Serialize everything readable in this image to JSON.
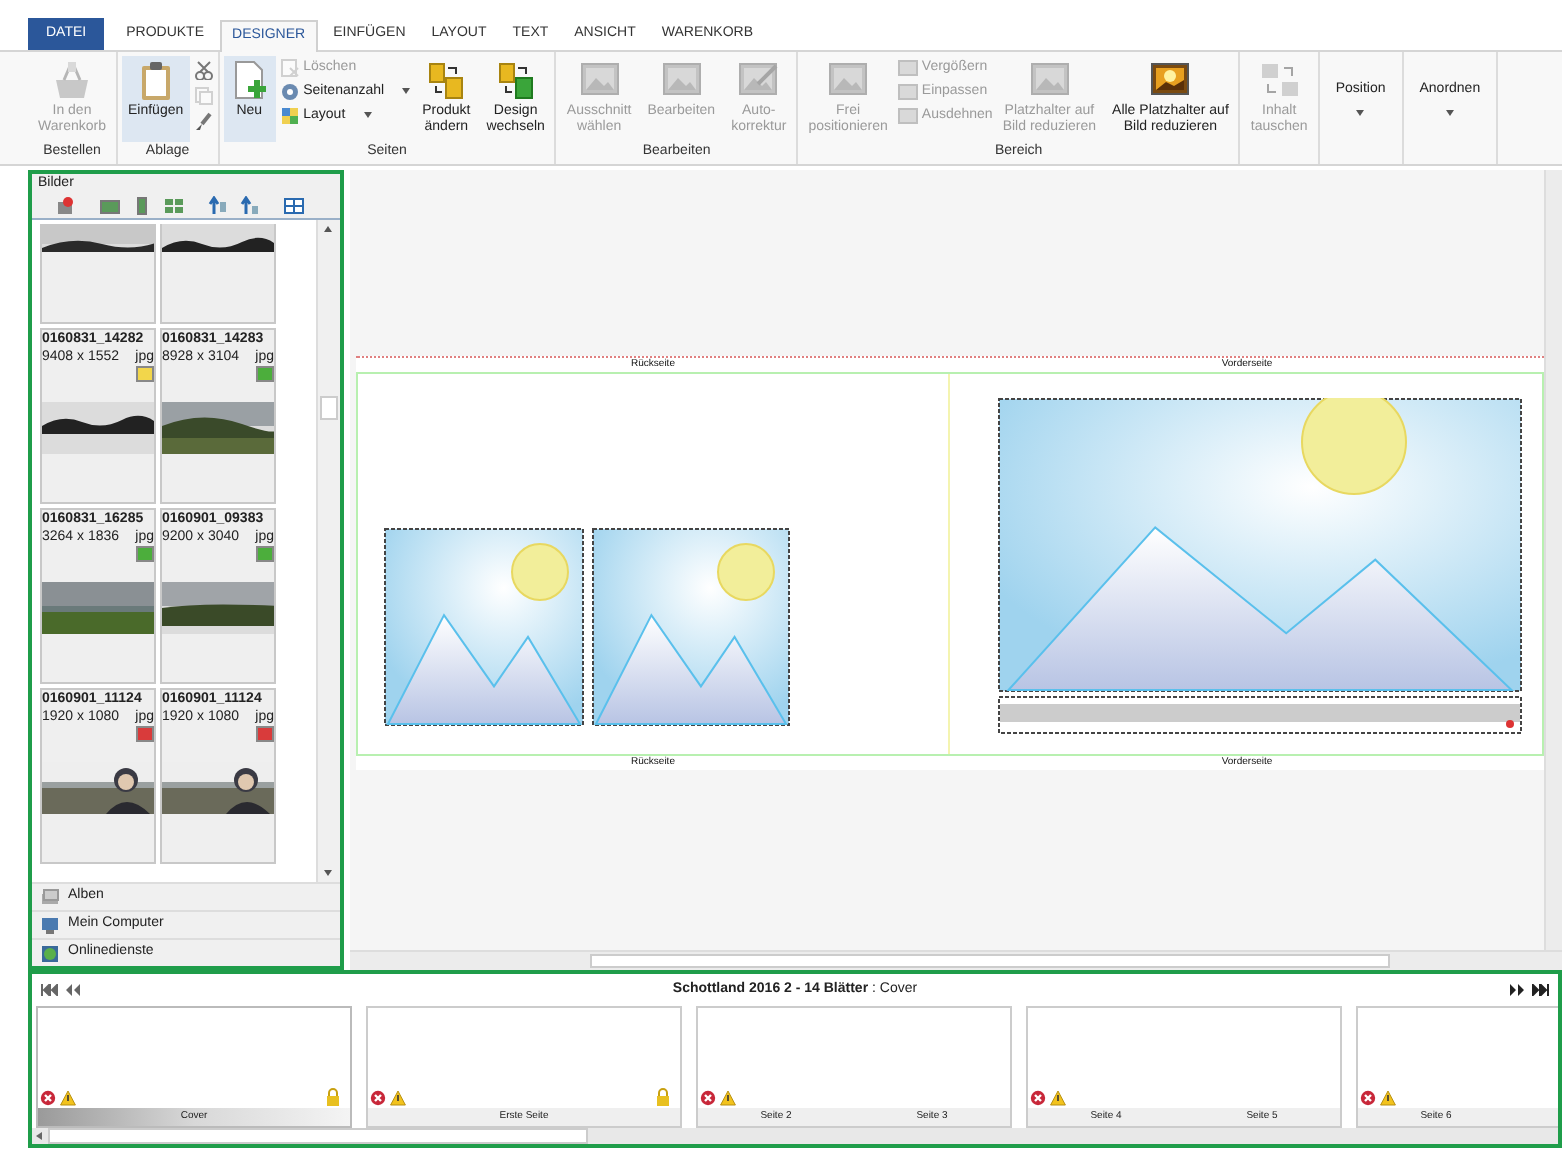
{
  "tabs": [
    {
      "label": "DATEI",
      "kind": "file",
      "selected": false
    },
    {
      "label": "PRODUKTE",
      "kind": "tab",
      "selected": false
    },
    {
      "label": "DESIGNER",
      "kind": "tab",
      "selected": true
    },
    {
      "label": "EINFÜGEN",
      "kind": "tab",
      "selected": false
    },
    {
      "label": "LAYOUT",
      "kind": "tab",
      "selected": false
    },
    {
      "label": "TEXT",
      "kind": "tab",
      "selected": false
    },
    {
      "label": "ANSICHT",
      "kind": "tab",
      "selected": false
    },
    {
      "label": "WARENKORB",
      "kind": "tab",
      "selected": false
    }
  ],
  "ribbon": {
    "groups": [
      {
        "label": "Bestellen",
        "buttons": [
          {
            "kind": "large",
            "label": "In den\nWarenkorb",
            "disabled": true,
            "selected": false
          }
        ]
      },
      {
        "label": "Ablage",
        "buttons": [
          {
            "kind": "large",
            "label": "Einfügen",
            "disabled": false,
            "selected": true
          },
          {
            "kind": "icons",
            "items": [
              {
                "disabled": false
              },
              {
                "disabled": true
              },
              {
                "disabled": false
              }
            ]
          }
        ]
      },
      {
        "label": "Seiten",
        "buttons": [
          {
            "kind": "large",
            "label": "Neu",
            "disabled": false,
            "selected": true
          },
          {
            "kind": "stack",
            "items": [
              {
                "label": "Löschen",
                "disabled": true,
                "dropdown": false
              },
              {
                "label": "Seitenanzahl",
                "disabled": false,
                "dropdown": true
              },
              {
                "label": "Layout",
                "disabled": false,
                "dropdown": true
              }
            ]
          },
          {
            "kind": "large",
            "label": "Produkt\nändern",
            "disabled": false,
            "selected": false
          },
          {
            "kind": "large",
            "label": "Design\nwechseln",
            "disabled": false,
            "selected": false
          }
        ]
      },
      {
        "label": "Bearbeiten",
        "buttons": [
          {
            "kind": "large",
            "label": "Ausschnitt\nwählen",
            "disabled": true,
            "selected": false
          },
          {
            "kind": "large",
            "label": "Bearbeiten",
            "disabled": true,
            "selected": false
          },
          {
            "kind": "large",
            "label": "Auto-\nkorrektur",
            "disabled": true,
            "selected": false
          }
        ]
      },
      {
        "label": "Bereich",
        "buttons": [
          {
            "kind": "large",
            "label": "Frei\npositionieren",
            "disabled": true,
            "selected": false
          },
          {
            "kind": "stack",
            "items": [
              {
                "label": "Vergößern",
                "disabled": true,
                "dropdown": false
              },
              {
                "label": "Einpassen",
                "disabled": true,
                "dropdown": false
              },
              {
                "label": "Ausdehnen",
                "disabled": true,
                "dropdown": false
              }
            ]
          },
          {
            "kind": "large",
            "label": "Platzhalter auf\nBild reduzieren",
            "disabled": true,
            "selected": false
          },
          {
            "kind": "large",
            "label": "Alle Platzhalter auf\nBild reduzieren",
            "disabled": false,
            "selected": false
          }
        ]
      },
      {
        "buttons": [
          {
            "kind": "large",
            "label": "Inhalt\ntauschen",
            "disabled": true,
            "selected": false
          }
        ]
      },
      {
        "buttons": [
          {
            "kind": "menu",
            "label": "Position"
          }
        ]
      },
      {
        "buttons": [
          {
            "kind": "menu",
            "label": "Anordnen"
          }
        ]
      }
    ]
  },
  "images_panel": {
    "title": "Bilder",
    "thumbnails": [
      {
        "kind": "cut"
      },
      {
        "kind": "cut"
      },
      {
        "kind": "full",
        "name": "0160831_14282",
        "size": "9408 x 1552",
        "type": "jpg",
        "color": "#f2d64b"
      },
      {
        "kind": "full",
        "name": "0160831_14283",
        "size": "8928 x 3104",
        "type": "jpg",
        "color": "#4cae3c"
      },
      {
        "kind": "full",
        "name": "0160831_16285",
        "size": "3264 x 1836",
        "type": "jpg",
        "color": "#4cae3c"
      },
      {
        "kind": "full",
        "name": "0160901_09383",
        "size": "9200 x 3040",
        "type": "jpg",
        "color": "#4cae3c"
      },
      {
        "kind": "full",
        "name": "0160901_11124",
        "size": "1920 x 1080",
        "type": "jpg",
        "color": "#d93b3b"
      },
      {
        "kind": "full",
        "name": "0160901_11124",
        "size": "1920 x 1080",
        "type": "jpg",
        "color": "#d93b3b"
      }
    ],
    "sources": [
      "Alben",
      "Mein Computer",
      "Onlinedienste"
    ]
  },
  "spread": {
    "top_labels": [
      "Rückseite",
      "Vorderseite"
    ],
    "bottom_labels": [
      "Rückseite",
      "Vorderseite"
    ]
  },
  "pages": {
    "title": "**Schottland 2016 2 - 14 Blätter** : Cover",
    "cards": [
      {
        "labels": [
          "Cover"
        ],
        "selected": true,
        "locked": true
      },
      {
        "labels": [
          "Erste Seite"
        ],
        "selected": false,
        "locked": true
      },
      {
        "labels": [
          "Seite 2",
          "Seite 3"
        ],
        "selected": false,
        "locked": false
      },
      {
        "labels": [
          "Seite 4",
          "Seite 5"
        ],
        "selected": false,
        "locked": false
      },
      {
        "labels": [
          "Seite 6"
        ],
        "selected": false,
        "locked": false
      }
    ]
  }
}
